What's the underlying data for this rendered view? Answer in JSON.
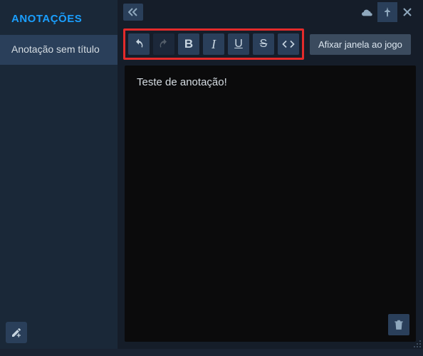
{
  "sidebar": {
    "title": "ANOTAÇÕES",
    "items": [
      {
        "label": "Anotação sem título"
      }
    ]
  },
  "toolbar": {
    "undo": "↺",
    "redo": "↻",
    "bold": "B",
    "italic": "I",
    "underline": "U",
    "strike": "S",
    "code": "</>",
    "pin_label": "Afixar janela ao jogo"
  },
  "editor": {
    "content": "Teste de anotação!"
  },
  "icons": {
    "collapse": "‹‹",
    "cloud": "cloud",
    "pin": "pin",
    "close": "×",
    "edit": "edit",
    "delete": "delete"
  }
}
